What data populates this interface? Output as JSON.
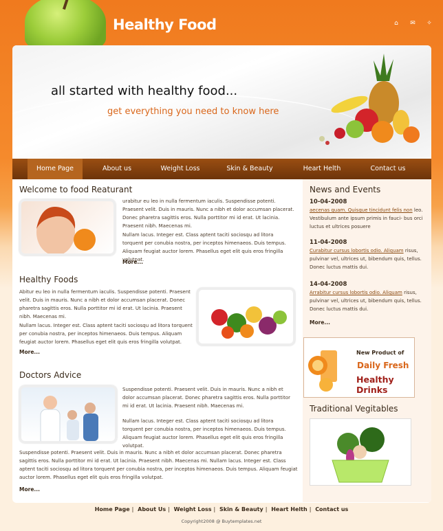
{
  "header": {
    "logo": "Healthy Food",
    "icons": [
      "home-icon",
      "mail-icon",
      "sitemap-icon"
    ]
  },
  "banner": {
    "headline": "all started with healthy food...",
    "tagline": "get everything you need to know here"
  },
  "nav": [
    {
      "label": "Home Page",
      "active": true
    },
    {
      "label": "About us"
    },
    {
      "label": "Weight Loss"
    },
    {
      "label": "Skin & Beauty"
    },
    {
      "label": "Heart Helth"
    },
    {
      "label": "Contact us"
    }
  ],
  "welcome": {
    "title": "Welcome to food Reaturant",
    "p1": "urabitur eu leo in nulla fermentum iaculis. Suspendisse potenti. Praesent velit. Duis in mauris. Nunc a nibh et dolor accumsan placerat. Donec pharetra sagittis eros. Nulla porttitor mi id erat. Ut lacinia. Praesent nibh. Maecenas mi.",
    "p2": "Nullam lacus. Integer est. Class aptent taciti sociosqu ad litora torquent per conubia nostra, per inceptos himenaeos. Duis tempus. Aliquam feugiat auctor lorem. Phasellus eget elit quis eros fringilla volutpat.",
    "more": "More..."
  },
  "healthy": {
    "title": "Healthy Foods",
    "p1": "Abitur eu leo in nulla fermentum iaculis. Suspendisse potenti. Praesent velit. Duis in mauris. Nunc a nibh et dolor accumsan placerat. Donec pharetra sagittis eros. Nulla porttitor mi id erat. Ut lacinia. Praesent nibh. Maecenas mi.",
    "p2": "Nullam lacus. Integer est. Class aptent taciti sociosqu ad litora torquent per conubia nostra, per inceptos himenaeos. Duis tempus. Aliquam feugiat auctor lorem. Phasellus eget elit quis eros fringilla volutpat.",
    "more": "More..."
  },
  "doctors": {
    "title": "Doctors Advice",
    "p1": "Suspendisse potenti. Praesent velit. Duis in mauris. Nunc a nibh et dolor accumsan placerat. Donec pharetra sagittis eros. Nulla porttitor mi id erat. Ut lacinia. Praesent nibh. Maecenas mi.",
    "p2": "Nullam lacus. Integer est. Class aptent taciti sociosqu ad litora torquent per conubia nostra, per inceptos himenaeos. Duis tempus. Aliquam feugiat auctor lorem. Phasellus eget elit quis eros fringilla volutpat.",
    "p3": "Suspendisse potenti. Praesent velit. Duis in mauris. Nunc a nibh et dolor accumsan placerat. Donec pharetra sagittis eros. Nulla porttitor mi id erat. Ut lacinia. Praesent nibh. Maecenas mi. Nullam lacus. Integer est. Class aptent taciti sociosqu ad litora torquent per conubia nostra, per inceptos himenaeos. Duis tempus. Aliquam feugiat auctor lorem. Phasellus eget elit quis eros fringilla volutpat.",
    "more": "More..."
  },
  "news": {
    "title": "News and Events",
    "items": [
      {
        "date": "10-04-2008",
        "link": "aecenas quam. Quisque tincidunt felis non",
        "text": "leo. Vestibulum ante ipsum primis in fauci- bus orci luctus et ultrices posuere"
      },
      {
        "date": "11-04-2008",
        "link": "Curabitur cursus lobortis odio. Aliquam",
        "text": "risus, pulvinar vel, ultrices ut, bibendum quis, tellus. Donec luctus mattis dui."
      },
      {
        "date": "14-04-2008",
        "link": "Arrabitur cursus lobortis odio. Aliquam",
        "text": "risus, pulvinar vel, ultrices ut, bibendum quis, tellus. Donec luctus mattis dui."
      }
    ],
    "more": "More..."
  },
  "promo": {
    "line1": "New Product of",
    "line2": "Daily Fresh",
    "line3": "Healthy Drinks"
  },
  "veg": {
    "title": "Traditional Vegitables"
  },
  "footer": {
    "links": [
      "Home Page",
      "About Us",
      "Weight Loss",
      "Skin & Beauty",
      "Heart Helth",
      "Contact us"
    ],
    "copyright": "Copyright2008 @ Buytemplates.net"
  },
  "colors": {
    "brand": "#f07a1e",
    "nav": "#7a3c0c",
    "accent": "#d9661a"
  }
}
